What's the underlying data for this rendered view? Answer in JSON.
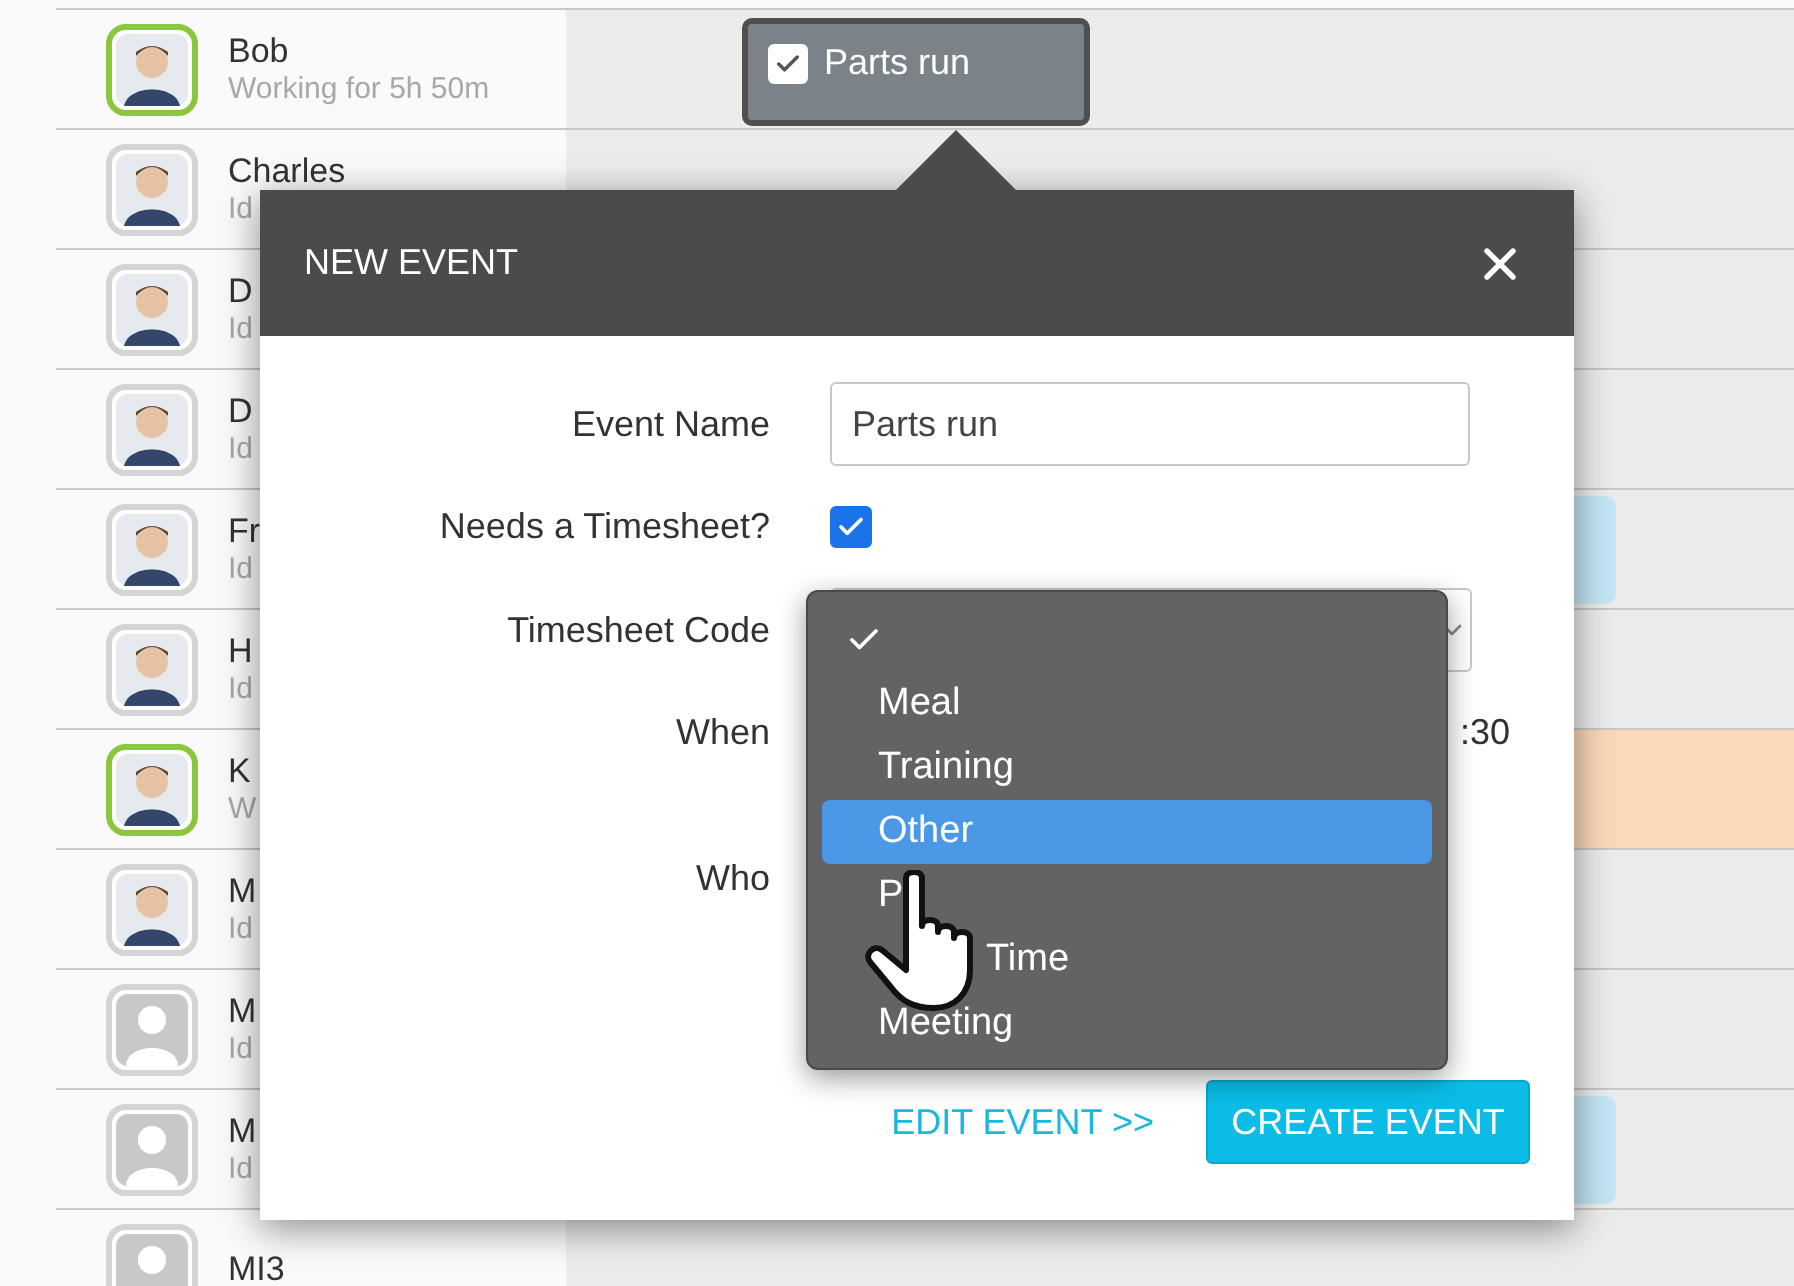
{
  "people": [
    {
      "name": "Bob",
      "status": "Working for 5h 50m",
      "active": true,
      "has_photo": true,
      "event": {
        "title": "Parts run",
        "checked": true
      }
    },
    {
      "name": "Charles",
      "status": "Id",
      "active": false,
      "has_photo": true
    },
    {
      "name": "D",
      "status": "Id",
      "active": false,
      "has_photo": true
    },
    {
      "name": "D",
      "status": "Id",
      "active": false,
      "has_photo": true
    },
    {
      "name": "Fr",
      "status": "Id",
      "active": false,
      "has_photo": true,
      "block": {
        "color": "#c4e6f5"
      }
    },
    {
      "name": "H",
      "status": "Id",
      "active": false,
      "has_photo": true
    },
    {
      "name": "K",
      "status": "W",
      "active": true,
      "has_photo": true,
      "block": {
        "color": "#fbd9b8"
      }
    },
    {
      "name": "M",
      "status": "Id",
      "active": false,
      "has_photo": true
    },
    {
      "name": "M",
      "status": "Id",
      "active": false,
      "has_photo": false
    },
    {
      "name": "M",
      "status": "Id",
      "active": false,
      "has_photo": false,
      "block": {
        "color": "#c4e6f5"
      }
    },
    {
      "name": "MI3",
      "active": false,
      "has_photo": false
    }
  ],
  "modal": {
    "title": "NEW EVENT",
    "fields": [
      {
        "kind": "text",
        "label": "Event Name",
        "value": "Parts run"
      },
      {
        "kind": "checkbox",
        "label": "Needs a Timesheet?",
        "checked": true
      },
      {
        "kind": "select",
        "label": "Timesheet Code"
      },
      {
        "kind": "time",
        "label": "When",
        "value": ":30"
      },
      {
        "kind": "people",
        "label": "Who"
      }
    ],
    "dropdown": {
      "options": [
        {
          "kind": "blank",
          "checked": true,
          "highlighted": false
        },
        {
          "kind": "option",
          "label": "Meal",
          "checked": false,
          "highlighted": false
        },
        {
          "kind": "option",
          "label": "Training",
          "checked": false,
          "highlighted": false
        },
        {
          "kind": "option",
          "label": "Other",
          "checked": false,
          "highlighted": true
        },
        {
          "kind": "option",
          "label": "P",
          "checked": false,
          "highlighted": false
        },
        {
          "kind": "option",
          "label": "Time",
          "checked": false,
          "highlighted": false,
          "indent": true
        },
        {
          "kind": "option",
          "label": "Meeting",
          "checked": false,
          "highlighted": false
        }
      ]
    },
    "link": "EDIT EVENT >>",
    "button": "CREATE EVENT"
  }
}
